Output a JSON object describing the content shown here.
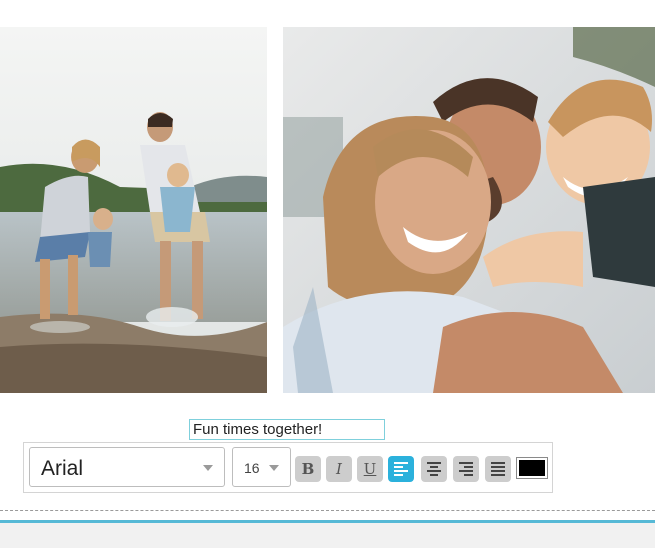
{
  "photos": [
    {
      "alt": "family-beach-photo",
      "icon": "photo"
    },
    {
      "alt": "family-hug-photo",
      "icon": "photo"
    }
  ],
  "caption": {
    "text": "Fun times together!"
  },
  "toolbar": {
    "font_family": "Arial",
    "font_size": "16",
    "bold_label": "B",
    "italic_label": "I",
    "underline_label": "U",
    "align_active": "left",
    "text_color": "#000000"
  },
  "colors": {
    "accent": "#2bb1dc",
    "button_bg": "#cdcdcd",
    "bottom_border": "#56b9d6"
  }
}
